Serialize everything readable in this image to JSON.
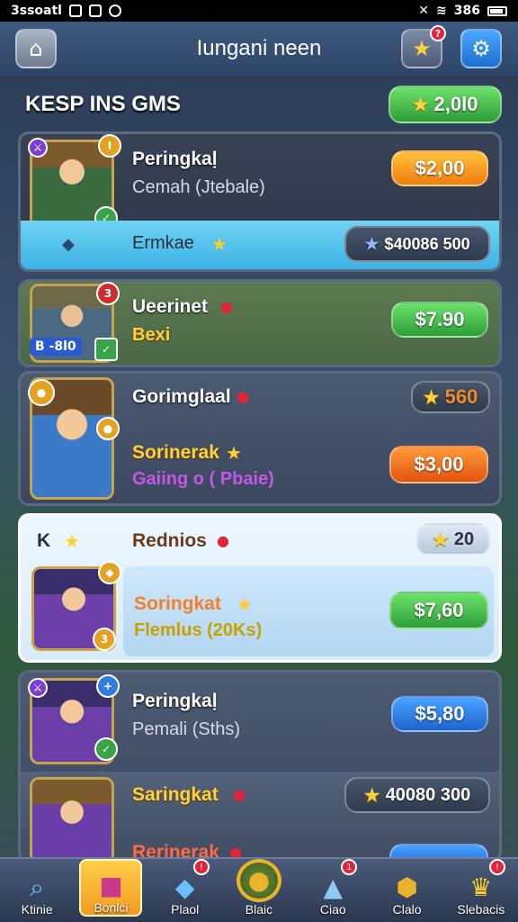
{
  "status_bar": {
    "left_text": "3ssoatl",
    "right_text": "386"
  },
  "header": {
    "title": "Iungani neen",
    "star_badge": "?"
  },
  "section": {
    "title": "KESP INS GMS",
    "balance": "2,0l0"
  },
  "cards": [
    {
      "title": "Peringkaḷ",
      "subtitle": "Cemah (Jtebale)",
      "price": "$2,00",
      "stripe_label": "Ermkae",
      "stripe_value": "$40086 500",
      "avatar_badge_top": "I",
      "avatar_badge_bottom": "✓"
    },
    {
      "title": "Ueerinet",
      "subtitle": "Bexi",
      "price": "$7.90",
      "tag": "B -8l0",
      "avatar_badge_top": "3"
    },
    {
      "title": "Gorimglaal",
      "stars_value": "560",
      "subtitle_title": "Sorinerak",
      "subtitle": "Gaiing o ( Pbaie)",
      "price": "$3,00"
    },
    {
      "header_left": "K",
      "title": "Rednios",
      "stars_value": "20",
      "subtitle_title": "Soringkat",
      "subtitle": "Flemlus (20Ks)",
      "price": "$7,60",
      "avatar_badge_bottom": "3"
    },
    {
      "title": "Peringkaḷ",
      "subtitle": "Pemali (Sths)",
      "price": "$5,80",
      "row2_title": "Saringkat",
      "row2_value": "40080 300",
      "row3_title": "Rerinerak"
    }
  ],
  "nav": [
    {
      "label": "Ktinie",
      "icon": "search-icon"
    },
    {
      "label": "Bonlci",
      "icon": "gift-icon"
    },
    {
      "label": "Plaol",
      "icon": "chat-icon",
      "badge": "!"
    },
    {
      "label": "Blaic",
      "icon": "globe-icon"
    },
    {
      "label": "Ciao",
      "icon": "gem-icon",
      "badge": "1"
    },
    {
      "label": "Clalo",
      "icon": "shield-icon"
    },
    {
      "label": "Slebacis",
      "icon": "trophy-icon",
      "badge": "!"
    }
  ]
}
